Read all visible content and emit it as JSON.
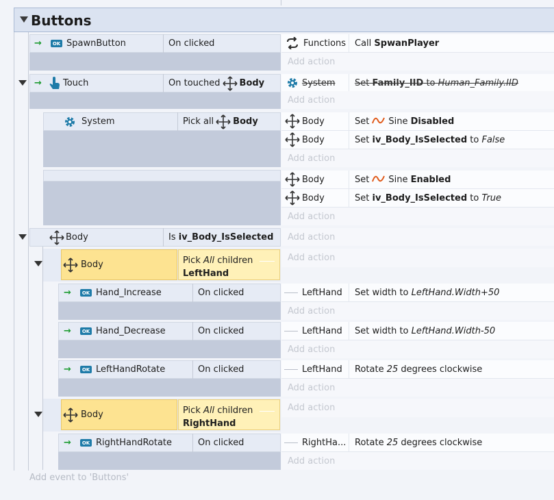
{
  "group": {
    "title": "Buttons"
  },
  "events": {
    "spawn": {
      "object": "SpawnButton",
      "condition": "On clicked",
      "action_object": "Functions",
      "action_prefix": "Call",
      "action_bold": "SpwanPlayer"
    },
    "touch": {
      "object": "Touch",
      "condition": "On touched",
      "condition_target": "Body",
      "action_object": "System",
      "action_set": "Set",
      "action_var": "Family_IID",
      "action_to": "to",
      "action_val": "Human_Family.IID"
    },
    "pick_all": {
      "object": "System",
      "condition": "Pick all",
      "condition_target": "Body",
      "actions": [
        {
          "object": "Body",
          "prefix": "Set",
          "behavior": "Sine",
          "state": "Disabled"
        },
        {
          "object": "Body",
          "prefix": "Set",
          "var": "iv_Body_IsSelected",
          "to": "to",
          "val": "False"
        }
      ]
    },
    "else_block": {
      "actions": [
        {
          "object": "Body",
          "prefix": "Set",
          "behavior": "Sine",
          "state": "Enabled"
        },
        {
          "object": "Body",
          "prefix": "Set",
          "var": "iv_Body_IsSelected",
          "to": "to",
          "val": "True"
        }
      ]
    },
    "body_selected": {
      "object": "Body",
      "condition_prefix": "Is",
      "condition_var": "iv_Body_IsSelected"
    },
    "left_pick": {
      "object": "Body",
      "line1_a": "Pick",
      "line1_b": "All",
      "line1_c": "children",
      "line2": "LeftHand"
    },
    "hand_increase": {
      "object": "Hand_Increase",
      "condition": "On clicked",
      "action_object": "LeftHand",
      "action_a": "Set width to",
      "action_b": "LeftHand.Width+50"
    },
    "hand_decrease": {
      "object": "Hand_Decrease",
      "condition": "On clicked",
      "action_object": "LeftHand",
      "action_a": "Set width to",
      "action_b": "LeftHand.Width-50"
    },
    "left_rotate": {
      "object": "LeftHandRotate",
      "condition": "On clicked",
      "action_object": "LeftHand",
      "action_a": "Rotate",
      "action_b": "25",
      "action_c": "degrees clockwise"
    },
    "right_pick": {
      "object": "Body",
      "line1_a": "Pick",
      "line1_b": "All",
      "line1_c": "children",
      "line2": "RightHand"
    },
    "right_rotate": {
      "object": "RightHandRotate",
      "condition": "On clicked",
      "action_object": "RightHa...",
      "action_a": "Rotate",
      "action_b": "25",
      "action_c": "degrees clockwise"
    }
  },
  "labels": {
    "add_action": "Add action",
    "add_event": "Add event to 'Buttons'",
    "ok": "OK"
  },
  "icons": {
    "arrow": "→"
  }
}
